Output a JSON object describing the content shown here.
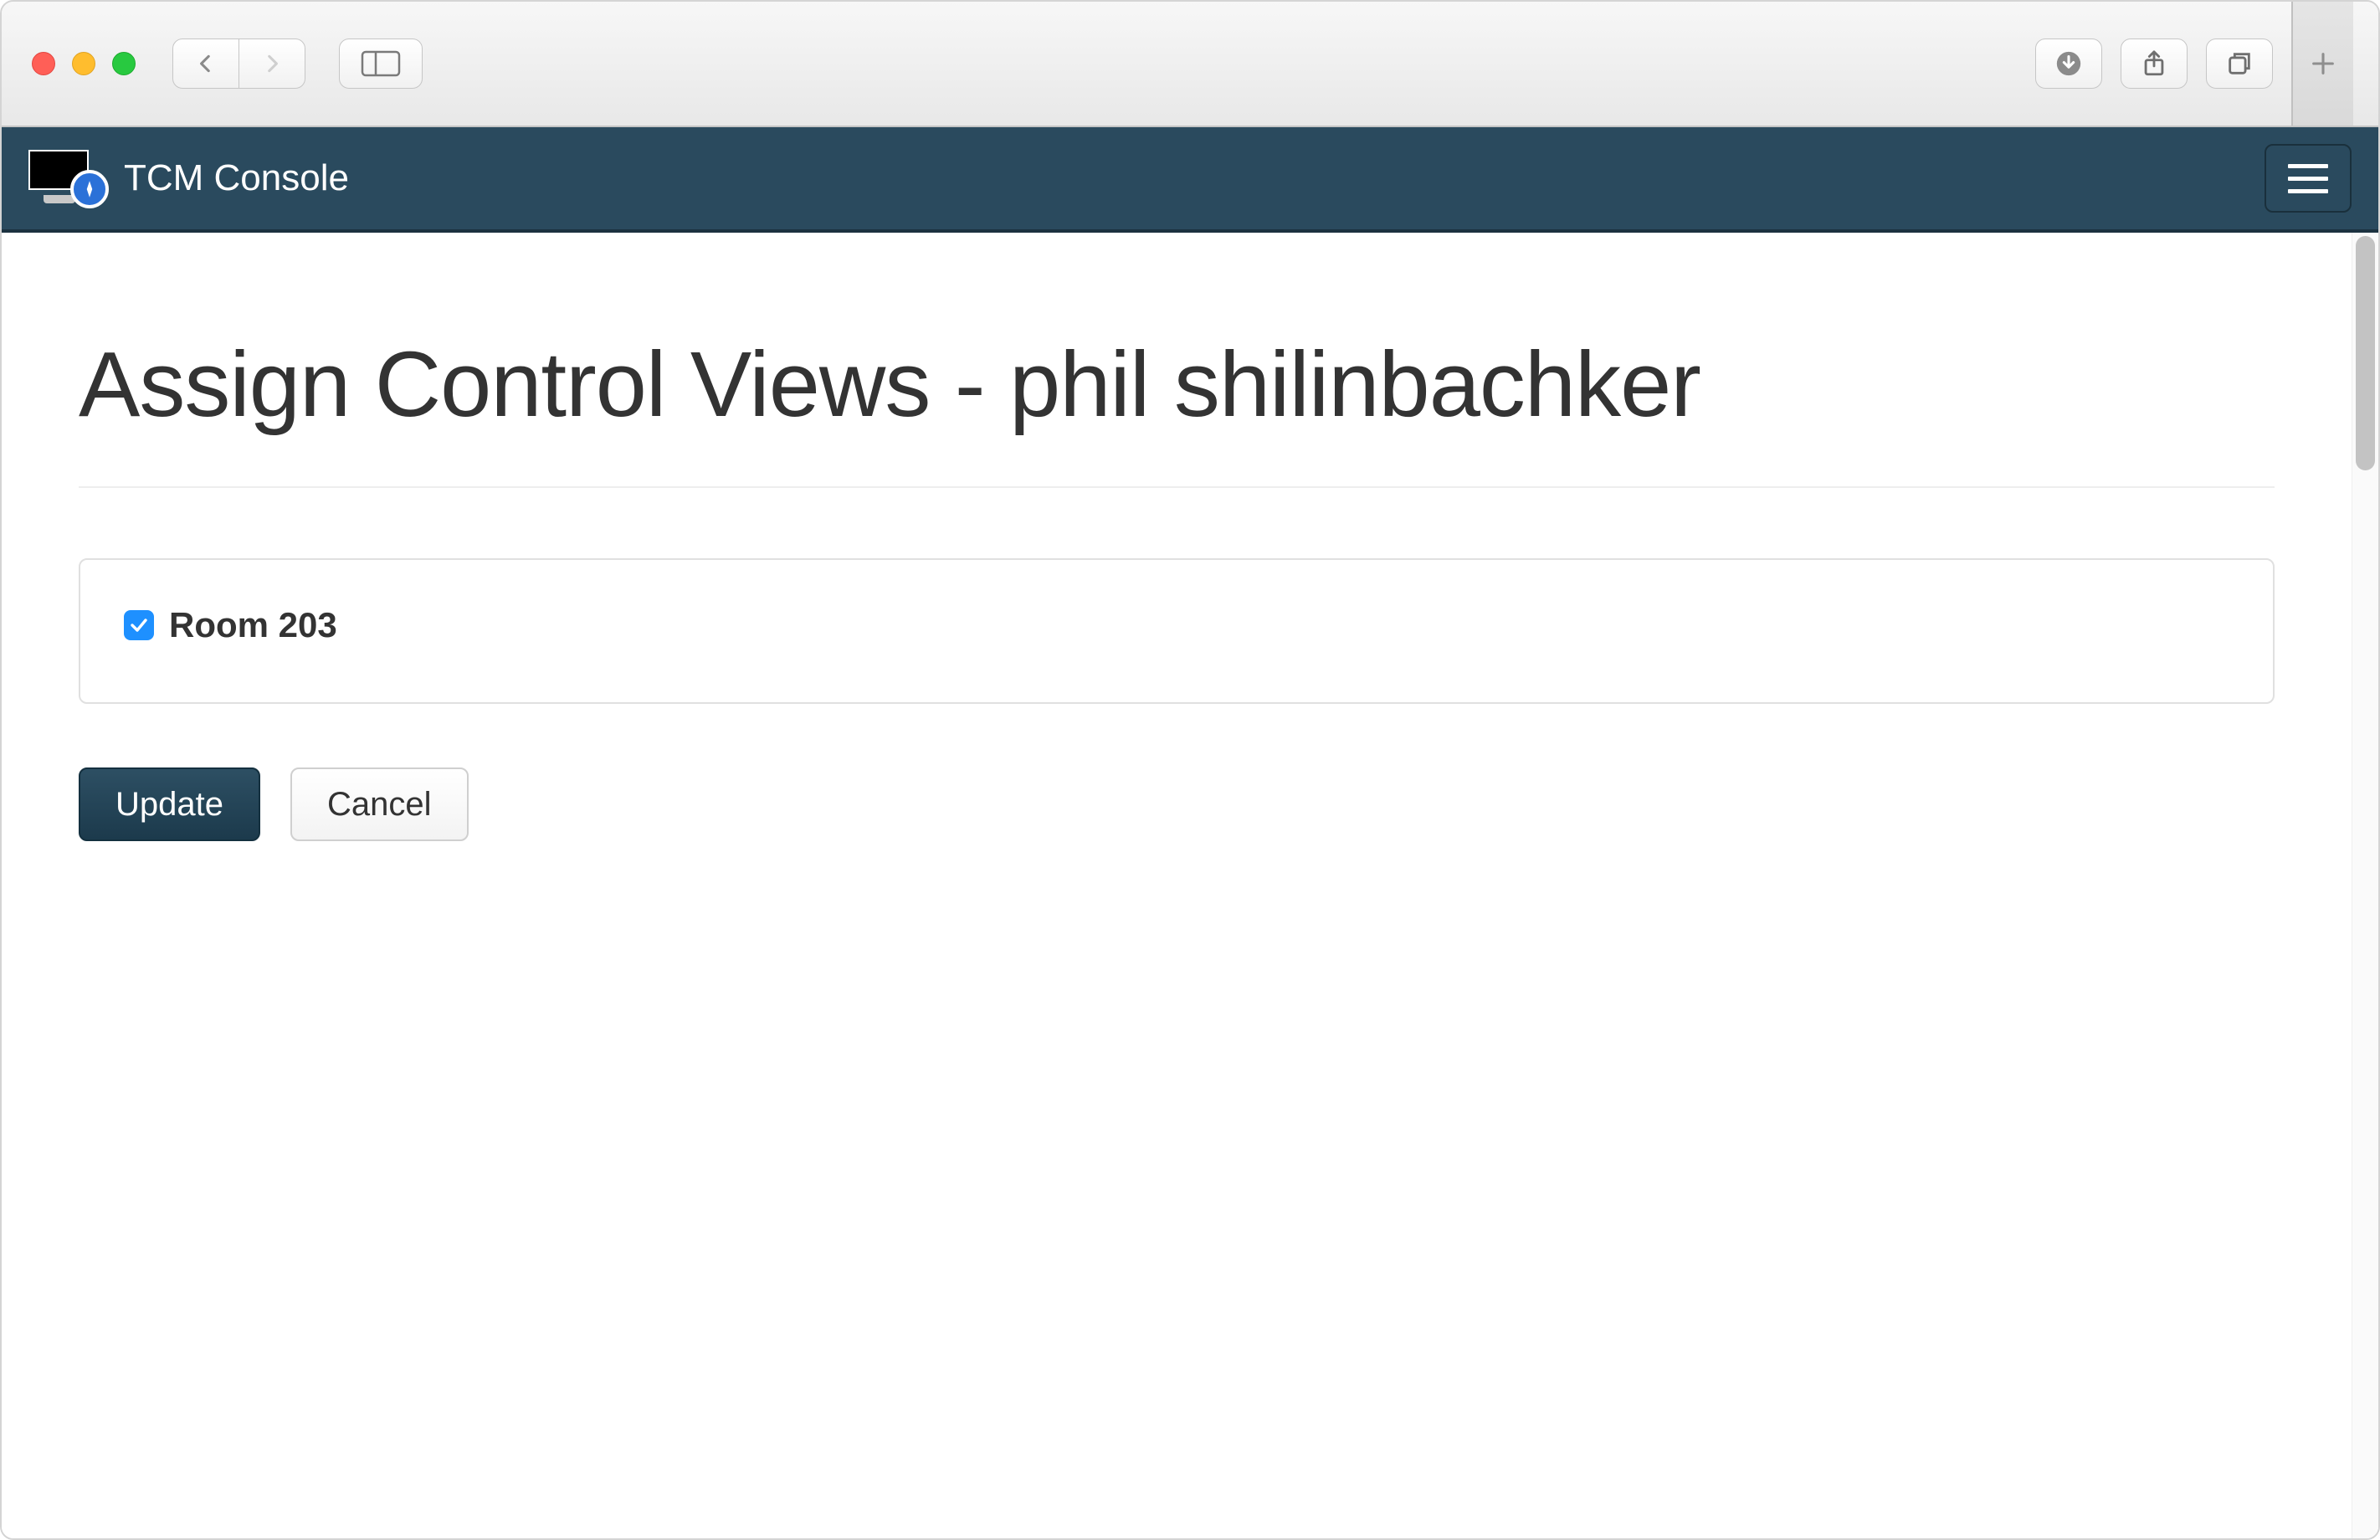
{
  "brand": {
    "title": "TCM Console"
  },
  "page": {
    "title": "Assign Control Views - phil shilinbachker"
  },
  "options": {
    "rooms": [
      {
        "label": "Room 203",
        "checked": true
      }
    ]
  },
  "buttons": {
    "update": "Update",
    "cancel": "Cancel"
  }
}
